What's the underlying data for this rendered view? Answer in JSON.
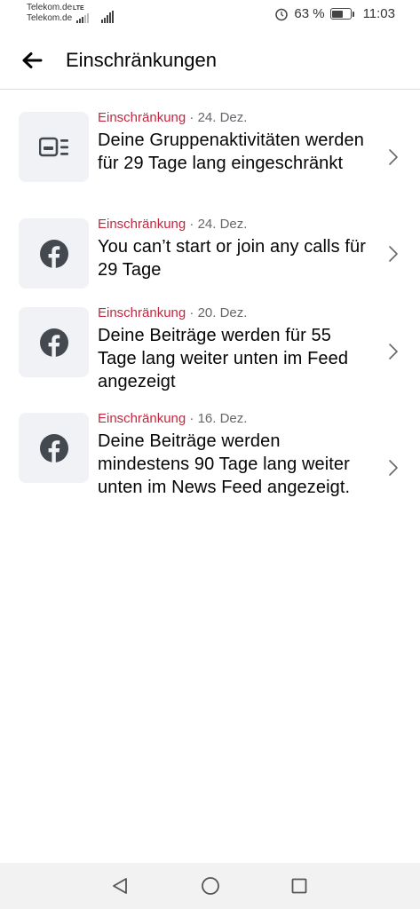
{
  "status_bar": {
    "carrier_1": "Telekom.de",
    "carrier_2": "Telekom.de",
    "network_badge": "LTE",
    "battery_percent": "63 %",
    "battery_level": 0.63,
    "time": "11:03"
  },
  "header": {
    "title": "Einschränkungen",
    "back_icon": "arrow-left-icon"
  },
  "restrictions": [
    {
      "icon": "group-activity-icon",
      "label": "Einschränkung",
      "separator": " · ",
      "date": "24. Dez.",
      "description": "Deine Gruppenaktivitäten werden für 29 Tage lang eingeschränkt"
    },
    {
      "icon": "facebook-icon",
      "label": "Einschränkung",
      "separator": " · ",
      "date": "24. Dez.",
      "description": "You can’t start or join any calls für 29 Tage"
    },
    {
      "icon": "facebook-icon",
      "label": "Einschränkung",
      "separator": " · ",
      "date": "20. Dez.",
      "description": "Deine Beiträge werden für 55 Tage lang weiter unten im Feed angezeigt"
    },
    {
      "icon": "facebook-icon",
      "label": "Einschränkung",
      "separator": " · ",
      "date": "16. Dez.",
      "description": "Deine Beiträge werden mindestens 90 Tage lang weiter unten im News Feed angezeigt."
    }
  ],
  "colors": {
    "label_red": "#c3273f",
    "meta_gray": "#65676b",
    "thumb_bg": "#f0f2f5",
    "icon_dark": "#444950"
  }
}
